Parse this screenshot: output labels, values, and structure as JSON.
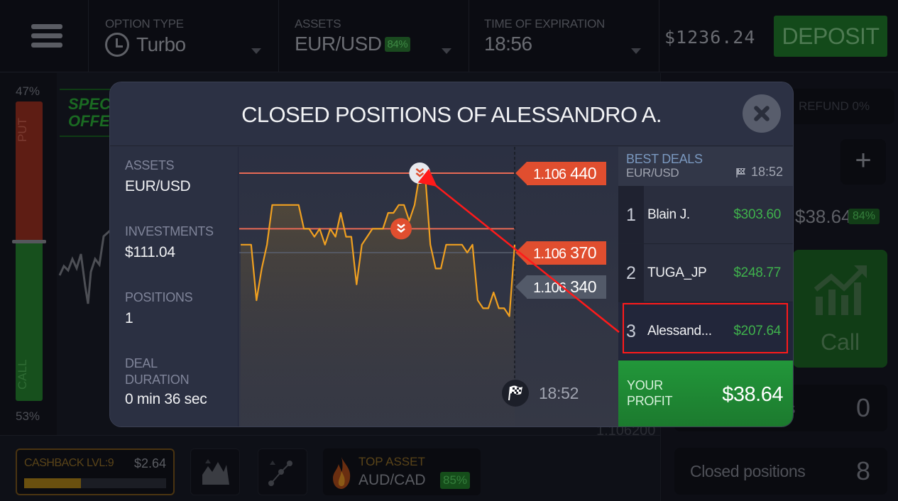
{
  "topbar": {
    "option_type_label": "OPTION TYPE",
    "option_type_value": "Turbo",
    "assets_label": "ASSETS",
    "assets_value": "EUR/USD",
    "assets_badge": "84%",
    "expiration_label": "TIME OF EXPIRATION",
    "expiration_value": "18:56",
    "balance": "$1236.24",
    "deposit_label": "DEPOSIT"
  },
  "left_panel": {
    "put_pct": "47%",
    "call_pct": "53%",
    "put_label": "PUT",
    "call_label": "CALL",
    "put_fraction": 0.47,
    "special_offer": "SPECIAL OFFER",
    "bg_price": "1.106200"
  },
  "right_panel": {
    "refund": "REFUND 0%",
    "plus": "+",
    "amount": "$38.64",
    "badge": "84%",
    "call_label": "Call",
    "open_positions_label": "Open positions",
    "open_positions_count": "0",
    "closed_positions_label": "Closed positions",
    "closed_positions_count": "8"
  },
  "bottom_bar": {
    "cashback_label": "CASHBACK LVL:9",
    "cashback_amount": "$2.64",
    "cashback_progress": 0.4,
    "top_asset_label": "TOP ASSET",
    "top_asset_value": "AUD/CAD",
    "top_asset_badge": "85%"
  },
  "modal": {
    "title": "CLOSED POSITIONS OF ALESSANDRO A.",
    "info": [
      {
        "label": "ASSETS",
        "value": "EUR/USD"
      },
      {
        "label": "INVESTMENTS",
        "value": "$111.04"
      },
      {
        "label": "POSITIONS",
        "value": "1"
      },
      {
        "label": "DEAL\nDURATION",
        "value": "0 min 36 sec"
      }
    ],
    "chart": {
      "price_tags": [
        {
          "prefix": "1.106",
          "suffix": "440",
          "kind": "close"
        },
        {
          "prefix": "1.106",
          "suffix": "370",
          "kind": "open"
        },
        {
          "prefix": "1.106",
          "suffix": "340",
          "kind": "current"
        }
      ],
      "finish_time": "18:52",
      "series": [
        1.10635,
        1.10635,
        1.10635,
        1.10628,
        1.10632,
        1.10635,
        1.1064,
        1.1064,
        1.1064,
        1.1064,
        1.1064,
        1.1064,
        1.10637,
        1.10637,
        1.10636,
        1.10637,
        1.10635,
        1.10637,
        1.10636,
        1.10639,
        1.10636,
        1.10636,
        1.1063,
        1.10635,
        1.10636,
        1.10637,
        1.10637,
        1.10637,
        1.10639,
        1.10639,
        1.1064,
        1.1064,
        1.10638,
        1.1064,
        1.10644,
        1.10644,
        1.10635,
        1.10632,
        1.10632,
        1.10635,
        1.10635,
        1.10635,
        1.10635,
        1.10634,
        1.10635,
        1.10628,
        1.10627,
        1.10627,
        1.10629,
        1.10627,
        1.10627,
        1.10626,
        1.10635
      ]
    },
    "best_deals": {
      "title": "BEST DEALS",
      "asset": "EUR/USD",
      "time": "18:52",
      "rows": [
        {
          "rank": "1",
          "name": "Blain J.",
          "amount": "$303.60"
        },
        {
          "rank": "2",
          "name": "TUGA_JP",
          "amount": "$248.77"
        },
        {
          "rank": "3",
          "name": "Alessand...",
          "amount": "$207.64"
        }
      ],
      "profit_label": "YOUR\nPROFIT",
      "profit_value": "$38.64"
    }
  }
}
